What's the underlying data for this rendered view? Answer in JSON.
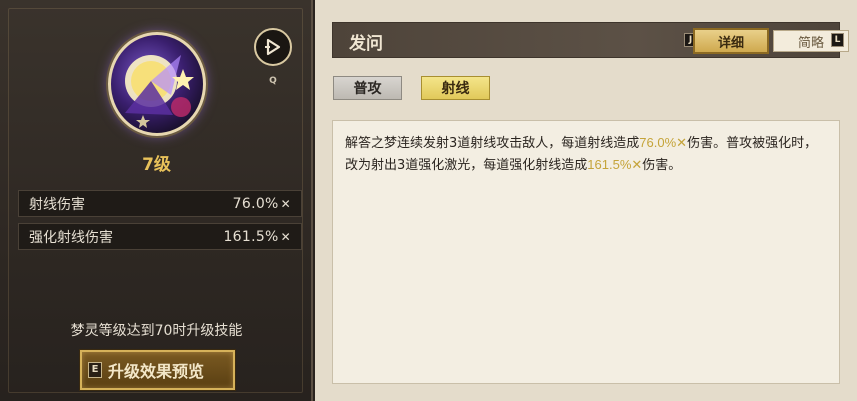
{
  "left": {
    "play_key": "Q",
    "level": "7级",
    "stats": [
      {
        "label": "射线伤害",
        "value": "76.0%"
      },
      {
        "label": "强化射线伤害",
        "value": "161.5%"
      }
    ],
    "upgrade_hint": "梦灵等级达到70时升级技能",
    "upgrade_key": "E",
    "upgrade_button": "升级效果预览"
  },
  "right": {
    "title": "发问",
    "tabs": {
      "detail_key": "J",
      "detail": "详细",
      "brief": "简略",
      "brief_key": "L"
    },
    "modes": [
      "普攻",
      "射线"
    ],
    "description": {
      "part1": "解答之梦连续发射3道射线攻击敌人，每道射线造成",
      "value1": "76.0%",
      "part2": "伤害。普攻被强化时，改为射出3道强化激光，每道强化射线造成",
      "value2": "161.5%",
      "part3": "伤害。"
    }
  },
  "colors": {
    "level": "#e8c25a",
    "highlight": "#c5a43a",
    "panel_dark": "#2e2823",
    "panel_light": "#e4dccb",
    "active_tab": "#e1c95a"
  },
  "icons": [
    "skill-emblem-icon",
    "play-icon",
    "multiplier-icon"
  ]
}
